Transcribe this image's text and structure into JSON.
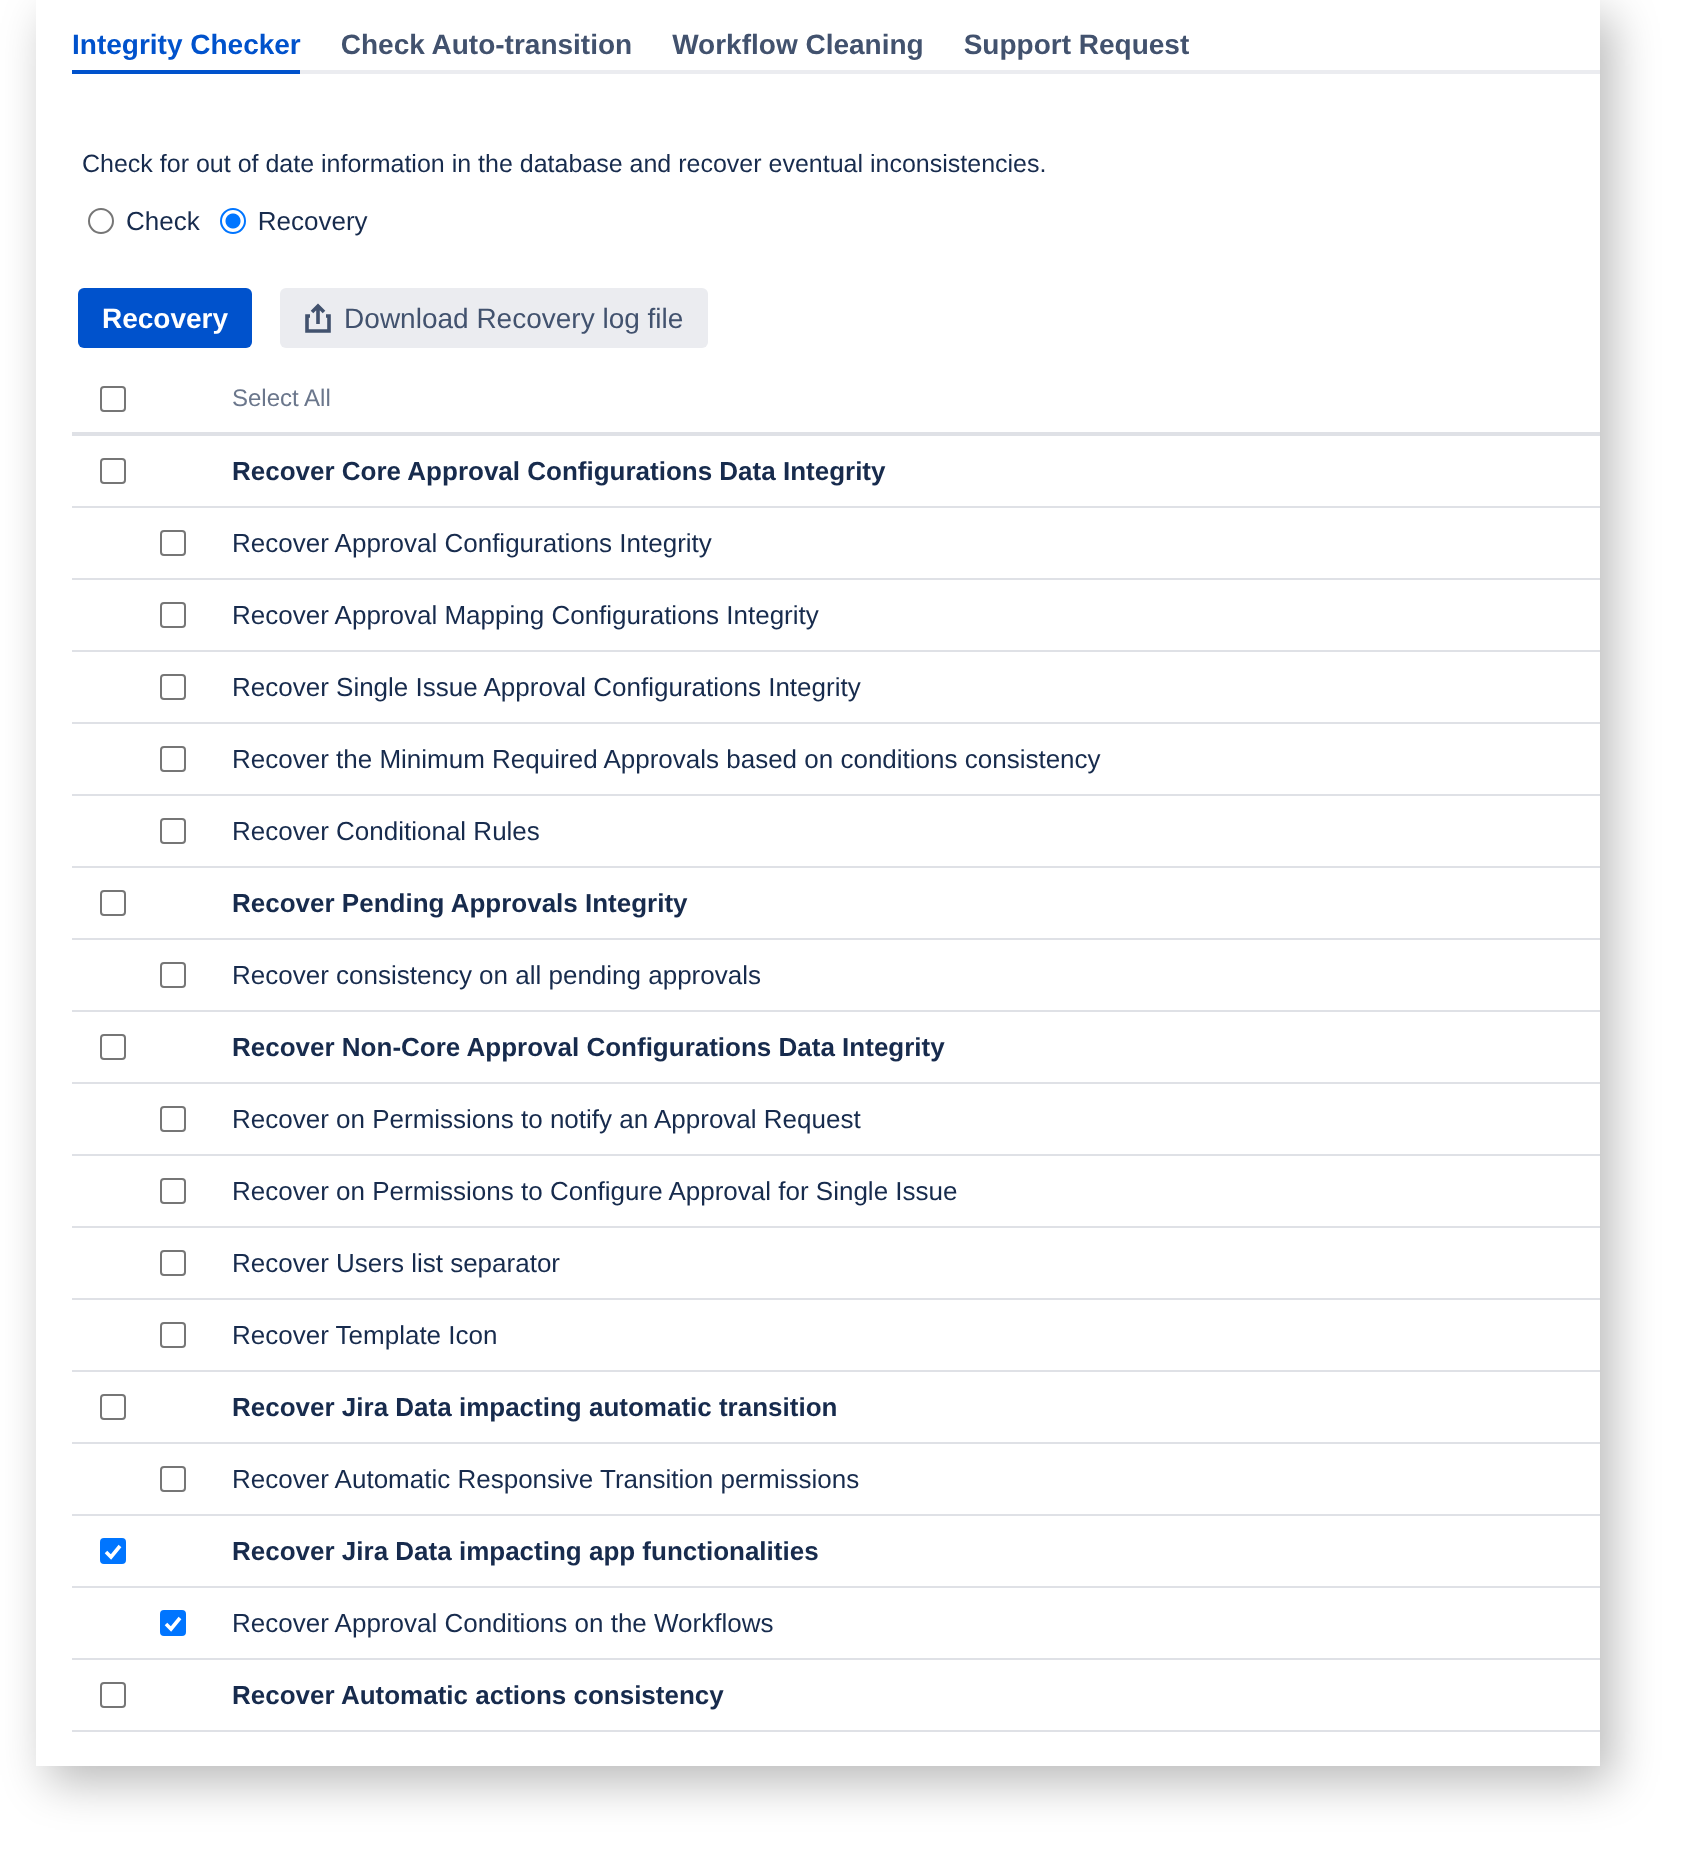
{
  "tabs": [
    {
      "label": "Integrity Checker",
      "selected": true
    },
    {
      "label": "Check Auto-transition",
      "selected": false
    },
    {
      "label": "Workflow Cleaning",
      "selected": false
    },
    {
      "label": "Support Request",
      "selected": false
    }
  ],
  "description": "Check for out of date information in the database and recover eventual inconsistencies.",
  "modes": [
    {
      "label": "Check",
      "selected": false
    },
    {
      "label": "Recovery",
      "selected": true
    }
  ],
  "buttons": {
    "primary": "Recovery",
    "download": "Download Recovery log file"
  },
  "select_all": {
    "label": "Select All",
    "checked": false
  },
  "groups": [
    {
      "label": "Recover Core Approval Configurations Data Integrity",
      "checked": false,
      "children": [
        {
          "label": "Recover Approval Configurations Integrity",
          "checked": false
        },
        {
          "label": "Recover Approval Mapping Configurations Integrity",
          "checked": false
        },
        {
          "label": "Recover Single Issue Approval Configurations Integrity",
          "checked": false
        },
        {
          "label": "Recover the Minimum Required Approvals based on conditions consistency",
          "checked": false
        },
        {
          "label": "Recover Conditional Rules",
          "checked": false
        }
      ]
    },
    {
      "label": "Recover Pending Approvals Integrity",
      "checked": false,
      "children": [
        {
          "label": "Recover consistency on all pending approvals",
          "checked": false
        }
      ]
    },
    {
      "label": "Recover Non-Core Approval Configurations Data Integrity",
      "checked": false,
      "children": [
        {
          "label": "Recover on Permissions to notify an Approval Request",
          "checked": false
        },
        {
          "label": "Recover on Permissions to Configure Approval for Single Issue",
          "checked": false
        },
        {
          "label": "Recover Users list separator",
          "checked": false
        },
        {
          "label": "Recover Template Icon",
          "checked": false
        }
      ]
    },
    {
      "label": "Recover Jira Data impacting automatic transition",
      "checked": false,
      "children": [
        {
          "label": "Recover Automatic Responsive Transition permissions",
          "checked": false
        }
      ]
    },
    {
      "label": "Recover Jira Data impacting app functionalities",
      "checked": true,
      "children": [
        {
          "label": "Recover Approval Conditions on the Workflows",
          "checked": true
        }
      ]
    },
    {
      "label": "Recover Automatic actions consistency",
      "checked": false
    }
  ]
}
